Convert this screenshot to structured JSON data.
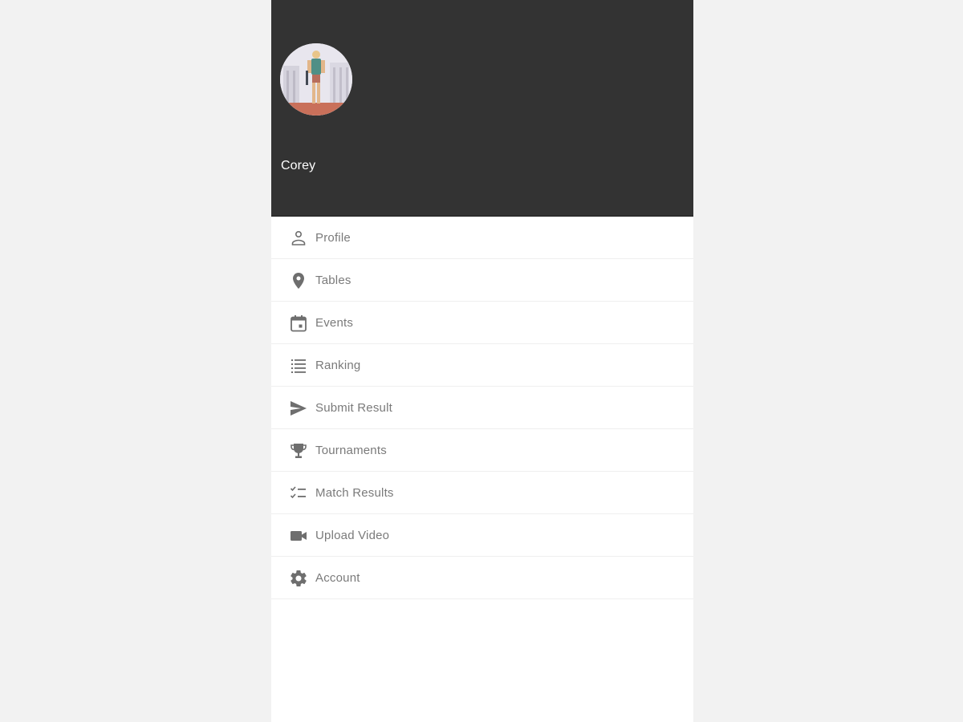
{
  "header": {
    "user_name": "Corey",
    "background_color": "#333333"
  },
  "menu": {
    "items": [
      {
        "label": "Profile",
        "icon": "person-icon"
      },
      {
        "label": "Tables",
        "icon": "location-pin-icon"
      },
      {
        "label": "Events",
        "icon": "calendar-icon"
      },
      {
        "label": "Ranking",
        "icon": "list-icon"
      },
      {
        "label": "Submit Result",
        "icon": "send-icon"
      },
      {
        "label": "Tournaments",
        "icon": "trophy-icon"
      },
      {
        "label": "Match Results",
        "icon": "checklist-icon"
      },
      {
        "label": "Upload Video",
        "icon": "video-camera-icon"
      },
      {
        "label": "Account",
        "icon": "gear-icon"
      }
    ],
    "icon_color": "#6e6e6e",
    "label_color": "#7a7a7a"
  }
}
